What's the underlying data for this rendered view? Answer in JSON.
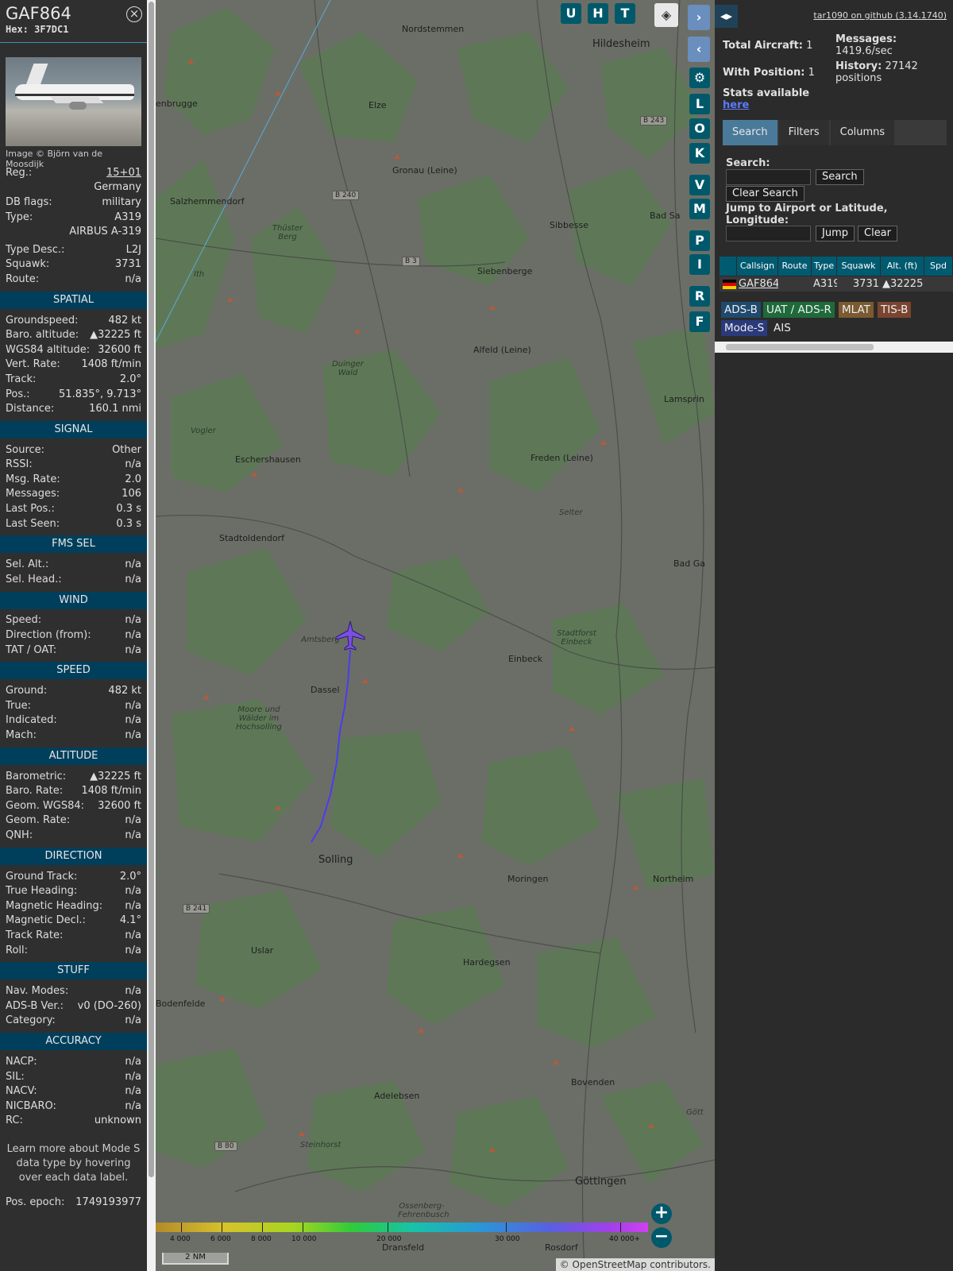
{
  "aircraft": {
    "callsign": "GAF864",
    "hex_label": "Hex: 3F7DC1",
    "image_credit": "Image © Björn van de Moosdijk",
    "basic": [
      {
        "k": "Reg.:",
        "v": "15+01"
      },
      {
        "k": "",
        "v": "Germany"
      },
      {
        "k": "DB flags:",
        "v": "military"
      },
      {
        "k": "Type:",
        "v": "A319"
      },
      {
        "k": "",
        "v": "AIRBUS A-319"
      },
      {
        "k": "Type Desc.:",
        "v": "L2J"
      },
      {
        "k": "Squawk:",
        "v": "3731"
      },
      {
        "k": "Route:",
        "v": "n/a"
      }
    ],
    "sections": [
      {
        "title": "SPATIAL",
        "rows": [
          {
            "k": "Groundspeed:",
            "v": "482 kt"
          },
          {
            "k": "Baro. altitude:",
            "v": "▲32225 ft"
          },
          {
            "k": "WGS84 altitude:",
            "v": "32600 ft"
          },
          {
            "k": "Vert. Rate:",
            "v": "1408 ft/min"
          },
          {
            "k": "Track:",
            "v": "2.0°"
          },
          {
            "k": "Pos.:",
            "v": "51.835°, 9.713°"
          },
          {
            "k": "Distance:",
            "v": "160.1 nmi"
          }
        ]
      },
      {
        "title": "SIGNAL",
        "rows": [
          {
            "k": "Source:",
            "v": "Other"
          },
          {
            "k": "RSSI:",
            "v": "n/a"
          },
          {
            "k": "Msg. Rate:",
            "v": "2.0"
          },
          {
            "k": "Messages:",
            "v": "106"
          },
          {
            "k": "Last Pos.:",
            "v": "0.3 s"
          },
          {
            "k": "Last Seen:",
            "v": "0.3 s"
          }
        ]
      },
      {
        "title": "FMS SEL",
        "rows": [
          {
            "k": "Sel. Alt.:",
            "v": "n/a"
          },
          {
            "k": "Sel. Head.:",
            "v": "n/a"
          }
        ]
      },
      {
        "title": "WIND",
        "rows": [
          {
            "k": "Speed:",
            "v": "n/a"
          },
          {
            "k": "Direction (from):",
            "v": "n/a"
          },
          {
            "k": "TAT / OAT:",
            "v": "n/a"
          }
        ]
      },
      {
        "title": "SPEED",
        "rows": [
          {
            "k": "Ground:",
            "v": "482 kt"
          },
          {
            "k": "True:",
            "v": "n/a"
          },
          {
            "k": "Indicated:",
            "v": "n/a"
          },
          {
            "k": "Mach:",
            "v": "n/a"
          }
        ]
      },
      {
        "title": "ALTITUDE",
        "rows": [
          {
            "k": "Barometric:",
            "v": "▲32225 ft"
          },
          {
            "k": "Baro. Rate:",
            "v": "1408 ft/min"
          },
          {
            "k": "Geom. WGS84:",
            "v": "32600 ft"
          },
          {
            "k": "Geom. Rate:",
            "v": "n/a"
          },
          {
            "k": "QNH:",
            "v": "n/a"
          }
        ]
      },
      {
        "title": "DIRECTION",
        "rows": [
          {
            "k": "Ground Track:",
            "v": "2.0°"
          },
          {
            "k": "True Heading:",
            "v": "n/a"
          },
          {
            "k": "Magnetic Heading:",
            "v": "n/a"
          },
          {
            "k": "Magnetic Decl.:",
            "v": "4.1°"
          },
          {
            "k": "Track Rate:",
            "v": "n/a"
          },
          {
            "k": "Roll:",
            "v": "n/a"
          }
        ]
      },
      {
        "title": "STUFF",
        "rows": [
          {
            "k": "Nav. Modes:",
            "v": "n/a"
          },
          {
            "k": "ADS-B Ver.:",
            "v": "v0 (DO-260)"
          },
          {
            "k": "Category:",
            "v": "n/a"
          }
        ]
      },
      {
        "title": "ACCURACY",
        "rows": [
          {
            "k": "NACP:",
            "v": "n/a"
          },
          {
            "k": "SIL:",
            "v": "n/a"
          },
          {
            "k": "NACV:",
            "v": "n/a"
          },
          {
            "k": "NICBARO:",
            "v": "n/a"
          },
          {
            "k": "RC:",
            "v": "unknown"
          }
        ]
      }
    ],
    "learn_more": "Learn more about Mode S data type by hovering over each data label.",
    "pos_epoch_label": "Pos. epoch:",
    "pos_epoch": "1749193977"
  },
  "map": {
    "buttons_top": [
      "U",
      "H",
      "T"
    ],
    "side_buttons": [
      "L",
      "O",
      "K",
      "V",
      "M",
      "P",
      "I",
      "R",
      "F"
    ],
    "places": [
      {
        "name": "Nordstemmen"
      },
      {
        "name": "Hildesheim"
      },
      {
        "name": "enbrugge"
      },
      {
        "name": "Elze"
      },
      {
        "name": "Gronau (Leine)"
      },
      {
        "name": "Salzhemmendorf"
      },
      {
        "name": "Sibbesse"
      },
      {
        "name": "Bad Sa"
      },
      {
        "name": "Siebenberge"
      },
      {
        "name": "Ith"
      },
      {
        "name": "Thüster Berg"
      },
      {
        "name": "Duinger Wald"
      },
      {
        "name": "Alfeld (Leine)"
      },
      {
        "name": "Lamsprin"
      },
      {
        "name": "Vogler"
      },
      {
        "name": "Eschershausen"
      },
      {
        "name": "Freden (Leine)"
      },
      {
        "name": "Selter"
      },
      {
        "name": "Stadtoldendorf"
      },
      {
        "name": "Bad Ga"
      },
      {
        "name": "Amtsberg"
      },
      {
        "name": "Stadtforst Einbeck"
      },
      {
        "name": "Einbeck"
      },
      {
        "name": "Dassel"
      },
      {
        "name": "Moore und Wälder im Hochsolling"
      },
      {
        "name": "Solling"
      },
      {
        "name": "Northeim"
      },
      {
        "name": "Moringen"
      },
      {
        "name": "Uslar"
      },
      {
        "name": "Hardegsen"
      },
      {
        "name": "Bodenfelde"
      },
      {
        "name": "Bovenden"
      },
      {
        "name": "Adelebsen"
      },
      {
        "name": "Steinhorst"
      },
      {
        "name": "Göttingen"
      },
      {
        "name": "Ossenberg-Fehrenbusch"
      },
      {
        "name": "Rosdorf"
      },
      {
        "name": "Dransfeld"
      },
      {
        "name": "Gött"
      }
    ],
    "roads": [
      "B 243",
      "B 240",
      "B 3",
      "B 241",
      "B 80"
    ],
    "legend_ticks": [
      "4 000",
      "6 000",
      "8 000",
      "10 000",
      "20 000",
      "30 000",
      "40 000+"
    ],
    "scale": "2 NM",
    "attribution": "© OpenStreetMap contributors."
  },
  "right": {
    "github": "tar1090 on github (3.14.1740)",
    "total_aircraft_label": "Total Aircraft:",
    "total_aircraft": "1",
    "with_position_label": "With Position:",
    "with_position": "1",
    "messages_label": "Messages:",
    "messages": "1419.6/sec",
    "history_label": "History:",
    "history": "27142 positions",
    "stats_label": "Stats available",
    "stats_link": "here",
    "tabs": [
      "Search",
      "Filters",
      "Columns"
    ],
    "search_label": "Search:",
    "search_button": "Search",
    "clear_search_button": "Clear Search",
    "jump_label": "Jump to Airport or Latitude, Longitude:",
    "jump_button": "Jump",
    "clear_button": "Clear",
    "table_headers": [
      "Callsign",
      "Route",
      "Type",
      "Squawk",
      "Alt. (ft)",
      "Spd"
    ],
    "table_rows": [
      {
        "callsign": "GAF864",
        "route": "",
        "type": "A319",
        "squawk": "3731",
        "alt": "▲32225",
        "spd": ""
      }
    ],
    "sources": [
      "ADS-B",
      "UAT / ADS-R",
      "MLAT",
      "TIS-B",
      "Mode-S",
      "AIS"
    ]
  }
}
